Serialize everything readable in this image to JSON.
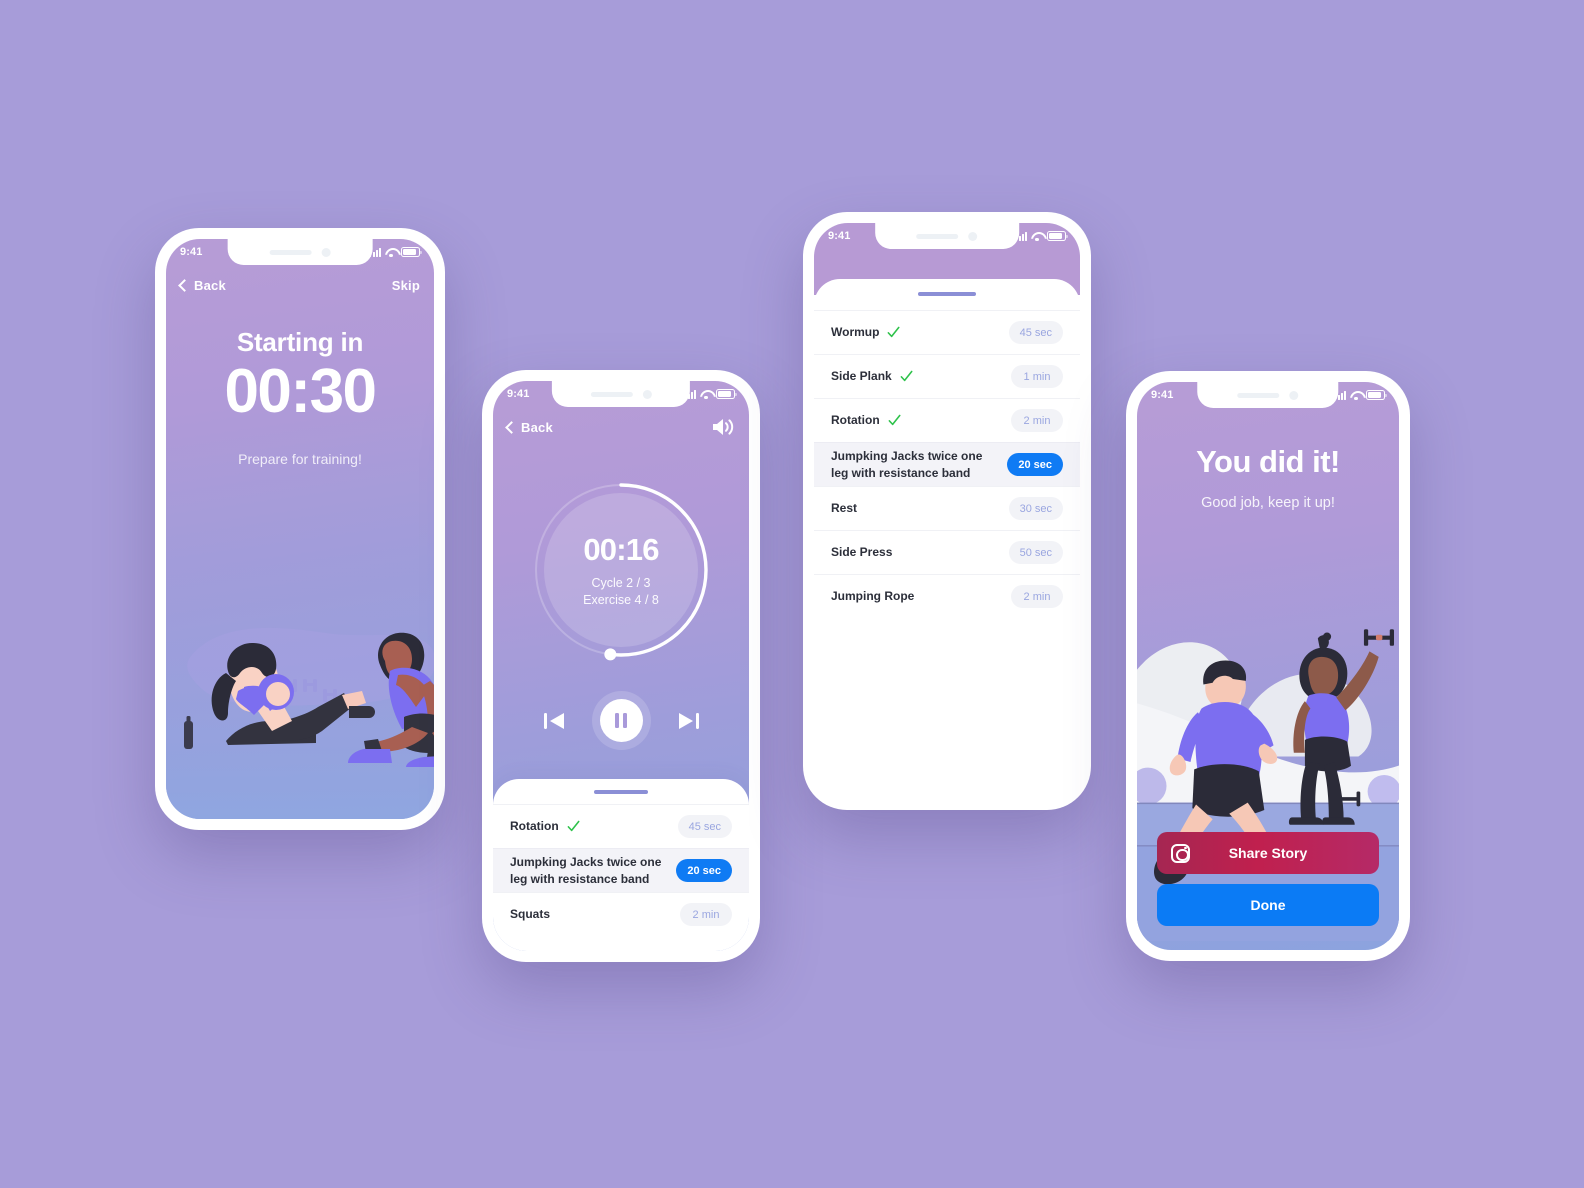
{
  "theme": {
    "page_background": "#a79cd9",
    "accent_blue": "#0f7bf4",
    "gradient_top": "#b79cd6",
    "gradient_bottom": "#8ca3de",
    "check_green": "#2ec24b",
    "pill_text": "#9aa6e0"
  },
  "status_bar": {
    "time": "9:41",
    "icons": [
      "signal-icon",
      "wifi-icon",
      "battery-icon"
    ]
  },
  "screen_countdown": {
    "nav": {
      "back_label": "Back",
      "skip_label": "Skip",
      "back_icon": "chevron-left-icon"
    },
    "title": "Starting in",
    "timer": "00:30",
    "subtitle": "Prepare for training!",
    "illustration": "two-people-situp-illustration"
  },
  "screen_player": {
    "nav": {
      "back_label": "Back",
      "back_icon": "chevron-left-icon",
      "sound_icon": "speaker-on-icon"
    },
    "timer": "00:16",
    "cycle": "Cycle 2 / 3",
    "exercise": "Exercise 4 / 8",
    "progress_percent": 52,
    "controls": {
      "previous_icon": "skip-previous-icon",
      "pause_icon": "pause-icon",
      "next_icon": "skip-next-icon"
    },
    "list": [
      {
        "name": "Rotation",
        "duration": "45 sec",
        "done": true,
        "active": false
      },
      {
        "name": "Jumpking Jacks twice one leg with resistance band",
        "duration": "20 sec",
        "done": false,
        "active": true
      },
      {
        "name": "Squats",
        "duration": "2 min",
        "done": false,
        "active": false
      }
    ]
  },
  "screen_exercise_list": {
    "list": [
      {
        "name": "Wormup",
        "duration": "45 sec",
        "done": true,
        "active": false
      },
      {
        "name": "Side Plank",
        "duration": "1 min",
        "done": true,
        "active": false
      },
      {
        "name": "Rotation",
        "duration": "2 min",
        "done": true,
        "active": false
      },
      {
        "name": "Jumpking Jacks twice one leg with resistance band",
        "duration": "20 sec",
        "done": false,
        "active": true
      },
      {
        "name": "Rest",
        "duration": "30 sec",
        "done": false,
        "active": false
      },
      {
        "name": "Side Press",
        "duration": "50 sec",
        "done": false,
        "active": false
      },
      {
        "name": "Jumping Rope",
        "duration": "2 min",
        "done": false,
        "active": false
      }
    ]
  },
  "screen_success": {
    "title": "You did it!",
    "subtitle": "Good job, keep it up!",
    "illustration": "runner-and-woman-with-dumbbell-illustration",
    "share_button": {
      "label": "Share Story",
      "icon": "instagram-icon"
    },
    "done_button": {
      "label": "Done"
    }
  }
}
